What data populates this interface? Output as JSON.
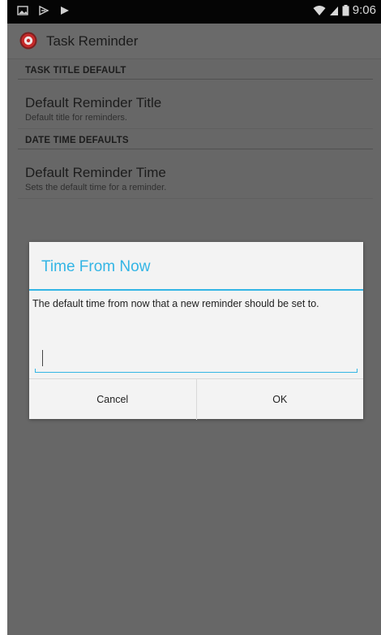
{
  "status_bar": {
    "time": "9:06",
    "icons_left": [
      "image-icon",
      "cast-icon",
      "play-store-icon"
    ],
    "icons_right": [
      "wifi-icon",
      "signal-icon",
      "battery-icon"
    ]
  },
  "action_bar": {
    "title": "Task Reminder",
    "icon": "app-logo-icon"
  },
  "preferences": {
    "category_1": "TASK TITLE DEFAULT",
    "item_1": {
      "title": "Default Reminder Title",
      "summary": "Default title for reminders."
    },
    "category_2": "DATE TIME DEFAULTS",
    "item_2": {
      "title": "Default Reminder Time",
      "summary": "Sets the default time for a reminder."
    }
  },
  "dialog": {
    "title": "Time From Now",
    "message": "The default time from now that a new reminder should be set to.",
    "input_value": "",
    "cancel_label": "Cancel",
    "ok_label": "OK"
  },
  "colors": {
    "accent": "#33b5e5",
    "dim_background": "#676767",
    "dialog_background": "#f3f3f3",
    "status_bar": "#050505"
  }
}
